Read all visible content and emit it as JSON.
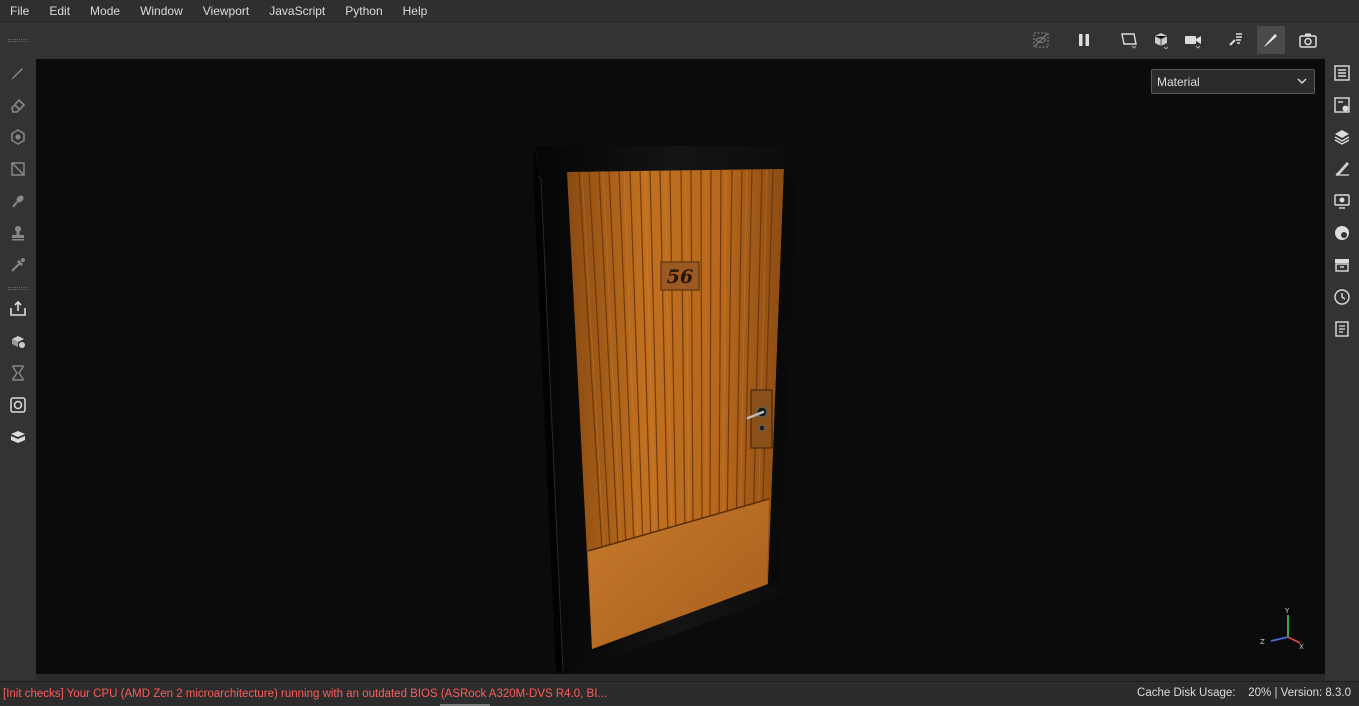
{
  "menu": {
    "items": [
      {
        "label": "File"
      },
      {
        "label": "Edit"
      },
      {
        "label": "Mode"
      },
      {
        "label": "Window"
      },
      {
        "label": "Viewport"
      },
      {
        "label": "JavaScript"
      },
      {
        "label": "Python"
      },
      {
        "label": "Help"
      }
    ]
  },
  "viewport": {
    "shading_mode": {
      "selected": "Material"
    },
    "door_number": "56",
    "gizmo": {
      "y_label": "Y",
      "x_label": "X",
      "z_label": "Z"
    },
    "colors": {
      "background": "#0b0b0b",
      "door_wood": "#b5671e",
      "frame": "#0e0e0e"
    }
  },
  "left_toolbar": {
    "tools": [
      "paint-brush-icon",
      "eraser-icon",
      "projection-icon",
      "polygon-fill-icon",
      "smudge-icon",
      "clone-stamp-icon",
      "color-picker-icon",
      "export-icon",
      "bake-icon",
      "iray-icon",
      "shelf-icon",
      "plugin-icon"
    ]
  },
  "top_toolbar": {
    "tools": [
      "hide-uv-icon",
      "pause-icon",
      "2d-view-icon",
      "3d-view-icon",
      "camera-icon",
      "bake-mode-icon",
      "paint-mode-icon",
      "screenshot-icon"
    ]
  },
  "right_toolbar": {
    "panels": [
      "layers-list-icon",
      "texture-set-settings-icon",
      "layers-stack-icon",
      "properties-icon",
      "display-settings-icon",
      "shader-settings-icon",
      "shelf-panel-icon",
      "history-icon",
      "log-icon"
    ]
  },
  "status": {
    "message": "[Init checks] Your CPU (AMD Zen 2 microarchitecture) running with an outdated BIOS (ASRock A320M-DVS R4.0, BI...",
    "cache_label": "Cache Disk Usage:",
    "cache_value": "20%",
    "version": "| Version: 8.3.0",
    "message_color": "#ff5a5a"
  }
}
